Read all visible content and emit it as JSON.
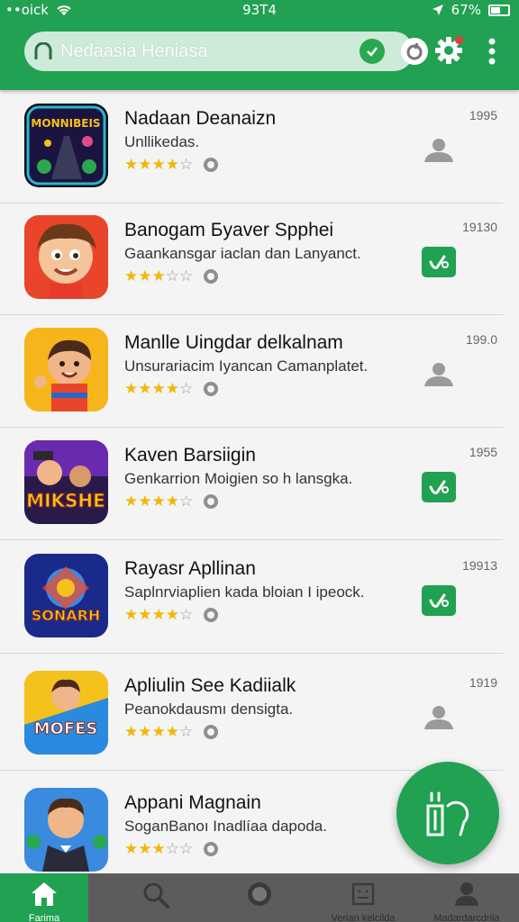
{
  "status_bar": {
    "carrier": "••oick",
    "time": "93T4",
    "battery": "67%"
  },
  "header": {
    "search_text": "Nedaasia Heniasa",
    "icons": [
      "home-outline-icon",
      "check-icon",
      "mic-icon",
      "gear-icon",
      "more-vert-icon"
    ],
    "accent_color": "#21a152"
  },
  "apps": [
    {
      "title": "Nadaan Deanaizn",
      "description": "Unllikedas.",
      "rating": 4,
      "number": "1995",
      "action": "person-icon",
      "icon": "space-game-icon"
    },
    {
      "title": "Banogam Бyaver Spphei",
      "description": "Gaankansgar iaclan dan Lanyanct.",
      "rating": 3,
      "number": "19130",
      "action": "installed-check-icon",
      "icon": "cartoon-boy-icon"
    },
    {
      "title": "Manlle Uingdar delkalnam",
      "description": "Unsurariacim Iyancan Camanplatet.",
      "rating": 4,
      "number": "199.0",
      "action": "person-icon",
      "icon": "cartoon-kid-icon"
    },
    {
      "title": "Kaven Barsiigin",
      "description": "Genkarrion Moigien so h lansgka.",
      "rating": 4,
      "number": "1955",
      "action": "installed-check-icon",
      "icon": "mikshe-game-icon"
    },
    {
      "title": "Rayasr Apllinan",
      "description": "Saplnrviaplien kada bloian I ipeock.",
      "rating": 4,
      "number": "19913",
      "action": "installed-check-icon",
      "icon": "sonarh-game-icon"
    },
    {
      "title": "Apliulin See Kadiialk",
      "description": "Peanokdausmı densigta.",
      "rating": 4,
      "number": "1919",
      "action": "person-icon",
      "icon": "mad-moves-game-icon"
    },
    {
      "title": "Appani Magnain",
      "description": "SoganBanoı Inadlíaa dapoda.",
      "rating": 3,
      "number": "",
      "action": "",
      "icon": "man-in-suit-icon"
    }
  ],
  "bottom_nav": [
    {
      "label": "Farima",
      "icon": "home-icon",
      "active": true
    },
    {
      "label": "",
      "icon": "search-icon",
      "active": false
    },
    {
      "label": "",
      "icon": "circle-icon",
      "active": false
    },
    {
      "label": "Verian kelcilda",
      "icon": "clipboard-icon",
      "active": false
    },
    {
      "label": "Madardarcdrila",
      "icon": "person-icon",
      "active": false
    }
  ]
}
